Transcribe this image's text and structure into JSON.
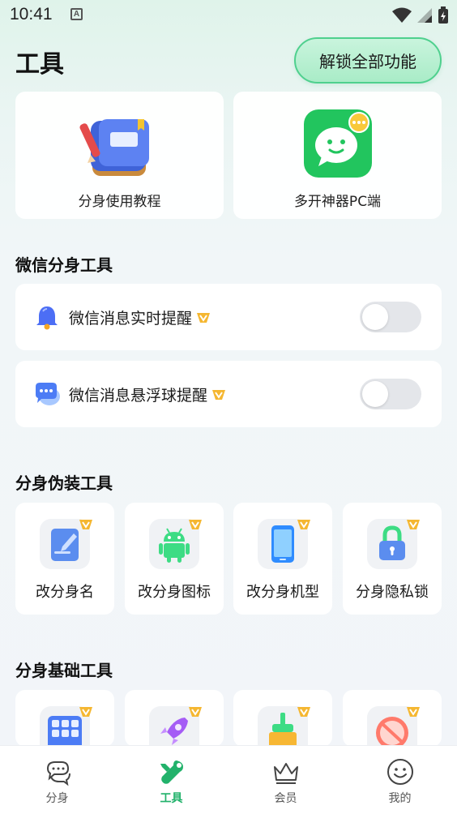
{
  "status_bar": {
    "time": "10:41",
    "notification_letter": "A"
  },
  "header": {
    "title": "工具",
    "unlock_label": "解锁全部功能"
  },
  "promo_cards": [
    {
      "label": "分身使用教程",
      "icon": "tutorial-book-icon"
    },
    {
      "label": "多开神器PC端",
      "icon": "chat-app-icon"
    }
  ],
  "wechat_section": {
    "title": "微信分身工具",
    "rows": [
      {
        "label": "微信消息实时提醒",
        "icon": "bell-icon",
        "enabled": false
      },
      {
        "label": "微信消息悬浮球提醒",
        "icon": "chat-bubble-icon",
        "enabled": false
      }
    ]
  },
  "disguise_section": {
    "title": "分身伪装工具",
    "tools": [
      {
        "label": "改分身名",
        "icon": "edit-name-icon"
      },
      {
        "label": "改分身图标",
        "icon": "android-icon"
      },
      {
        "label": "改分身机型",
        "icon": "phone-icon"
      },
      {
        "label": "分身隐私锁",
        "icon": "lock-icon"
      }
    ]
  },
  "basic_section": {
    "title": "分身基础工具",
    "tools": [
      {
        "icon": "grid-apps-icon"
      },
      {
        "icon": "rocket-icon"
      },
      {
        "icon": "broom-icon"
      },
      {
        "icon": "ad-block-icon"
      }
    ]
  },
  "bottom_nav": {
    "items": [
      {
        "label": "分身",
        "icon": "chat-bubbles-icon",
        "active": false
      },
      {
        "label": "工具",
        "icon": "wrench-icon",
        "active": true
      },
      {
        "label": "会员",
        "icon": "crown-icon",
        "active": false
      },
      {
        "label": "我的",
        "icon": "smiley-icon",
        "active": false
      }
    ]
  },
  "colors": {
    "accent": "#22b26b",
    "vip": "#f5b731",
    "unlock_bg": "#b6efd0"
  }
}
